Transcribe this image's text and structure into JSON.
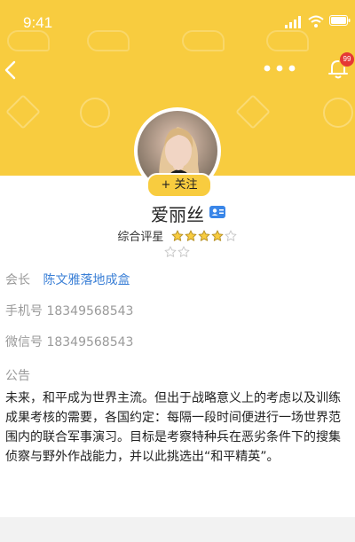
{
  "status_bar": {
    "time": "9:41"
  },
  "header": {
    "badge_count": "99",
    "icons": [
      "back-icon",
      "more-icon",
      "bell-icon"
    ]
  },
  "profile": {
    "follow_label": "+ 关注",
    "name": "爱丽丝",
    "rating_label": "综合评星",
    "rating_row1": {
      "filled": 4,
      "total": 5
    },
    "rating_row2": {
      "filled": 0,
      "total": 2
    }
  },
  "info": {
    "president_label": "会长",
    "president_value": "陈文雅落地成盒",
    "phone_label": "手机号",
    "phone_value": "18349568543",
    "wechat_label": "微信号",
    "wechat_value": "18349568543"
  },
  "notice": {
    "label": "公告",
    "text": "未来，和平成为世界主流。但出于战略意义上的考虑以及训练成果考核的需要，各国约定：每隔一段时间便进行一场世界范围内的联合军事演习。目标是考察特种兵在恶劣条件下的搜集侦察与野外作战能力，并以此挑选出“和平精英”。"
  },
  "colors": {
    "header_bg": "#f8cc3f",
    "link": "#3a7fd6",
    "star_fill": "#f8cc3f",
    "badge": "#e53935"
  }
}
